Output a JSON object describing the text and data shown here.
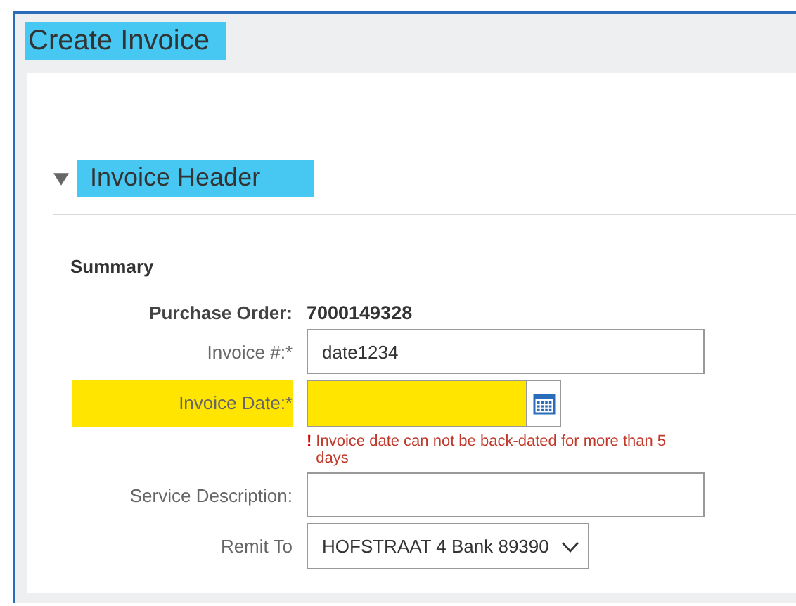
{
  "page": {
    "title": "Create Invoice",
    "highlighted": true
  },
  "section": {
    "title": "Invoice Header",
    "expanded": true,
    "highlighted": true
  },
  "summary": {
    "heading": "Summary",
    "fields": [
      {
        "kind": "static",
        "label": "Purchase Order:",
        "value": "7000149328",
        "highlighted": false
      },
      {
        "kind": "text",
        "label": "Invoice #:*",
        "value": "date1234",
        "highlighted": false
      },
      {
        "kind": "date",
        "label": "Invoice Date:*",
        "highlighted": true,
        "error_mark": "!",
        "error": "Invoice date can not be back-dated for more than 5 days"
      },
      {
        "kind": "text",
        "label": "Service Description:",
        "highlighted": false
      },
      {
        "kind": "select",
        "label": "Remit To",
        "value": "HOFSTRAAT 4 Bank 89390",
        "highlighted": false
      }
    ]
  }
}
